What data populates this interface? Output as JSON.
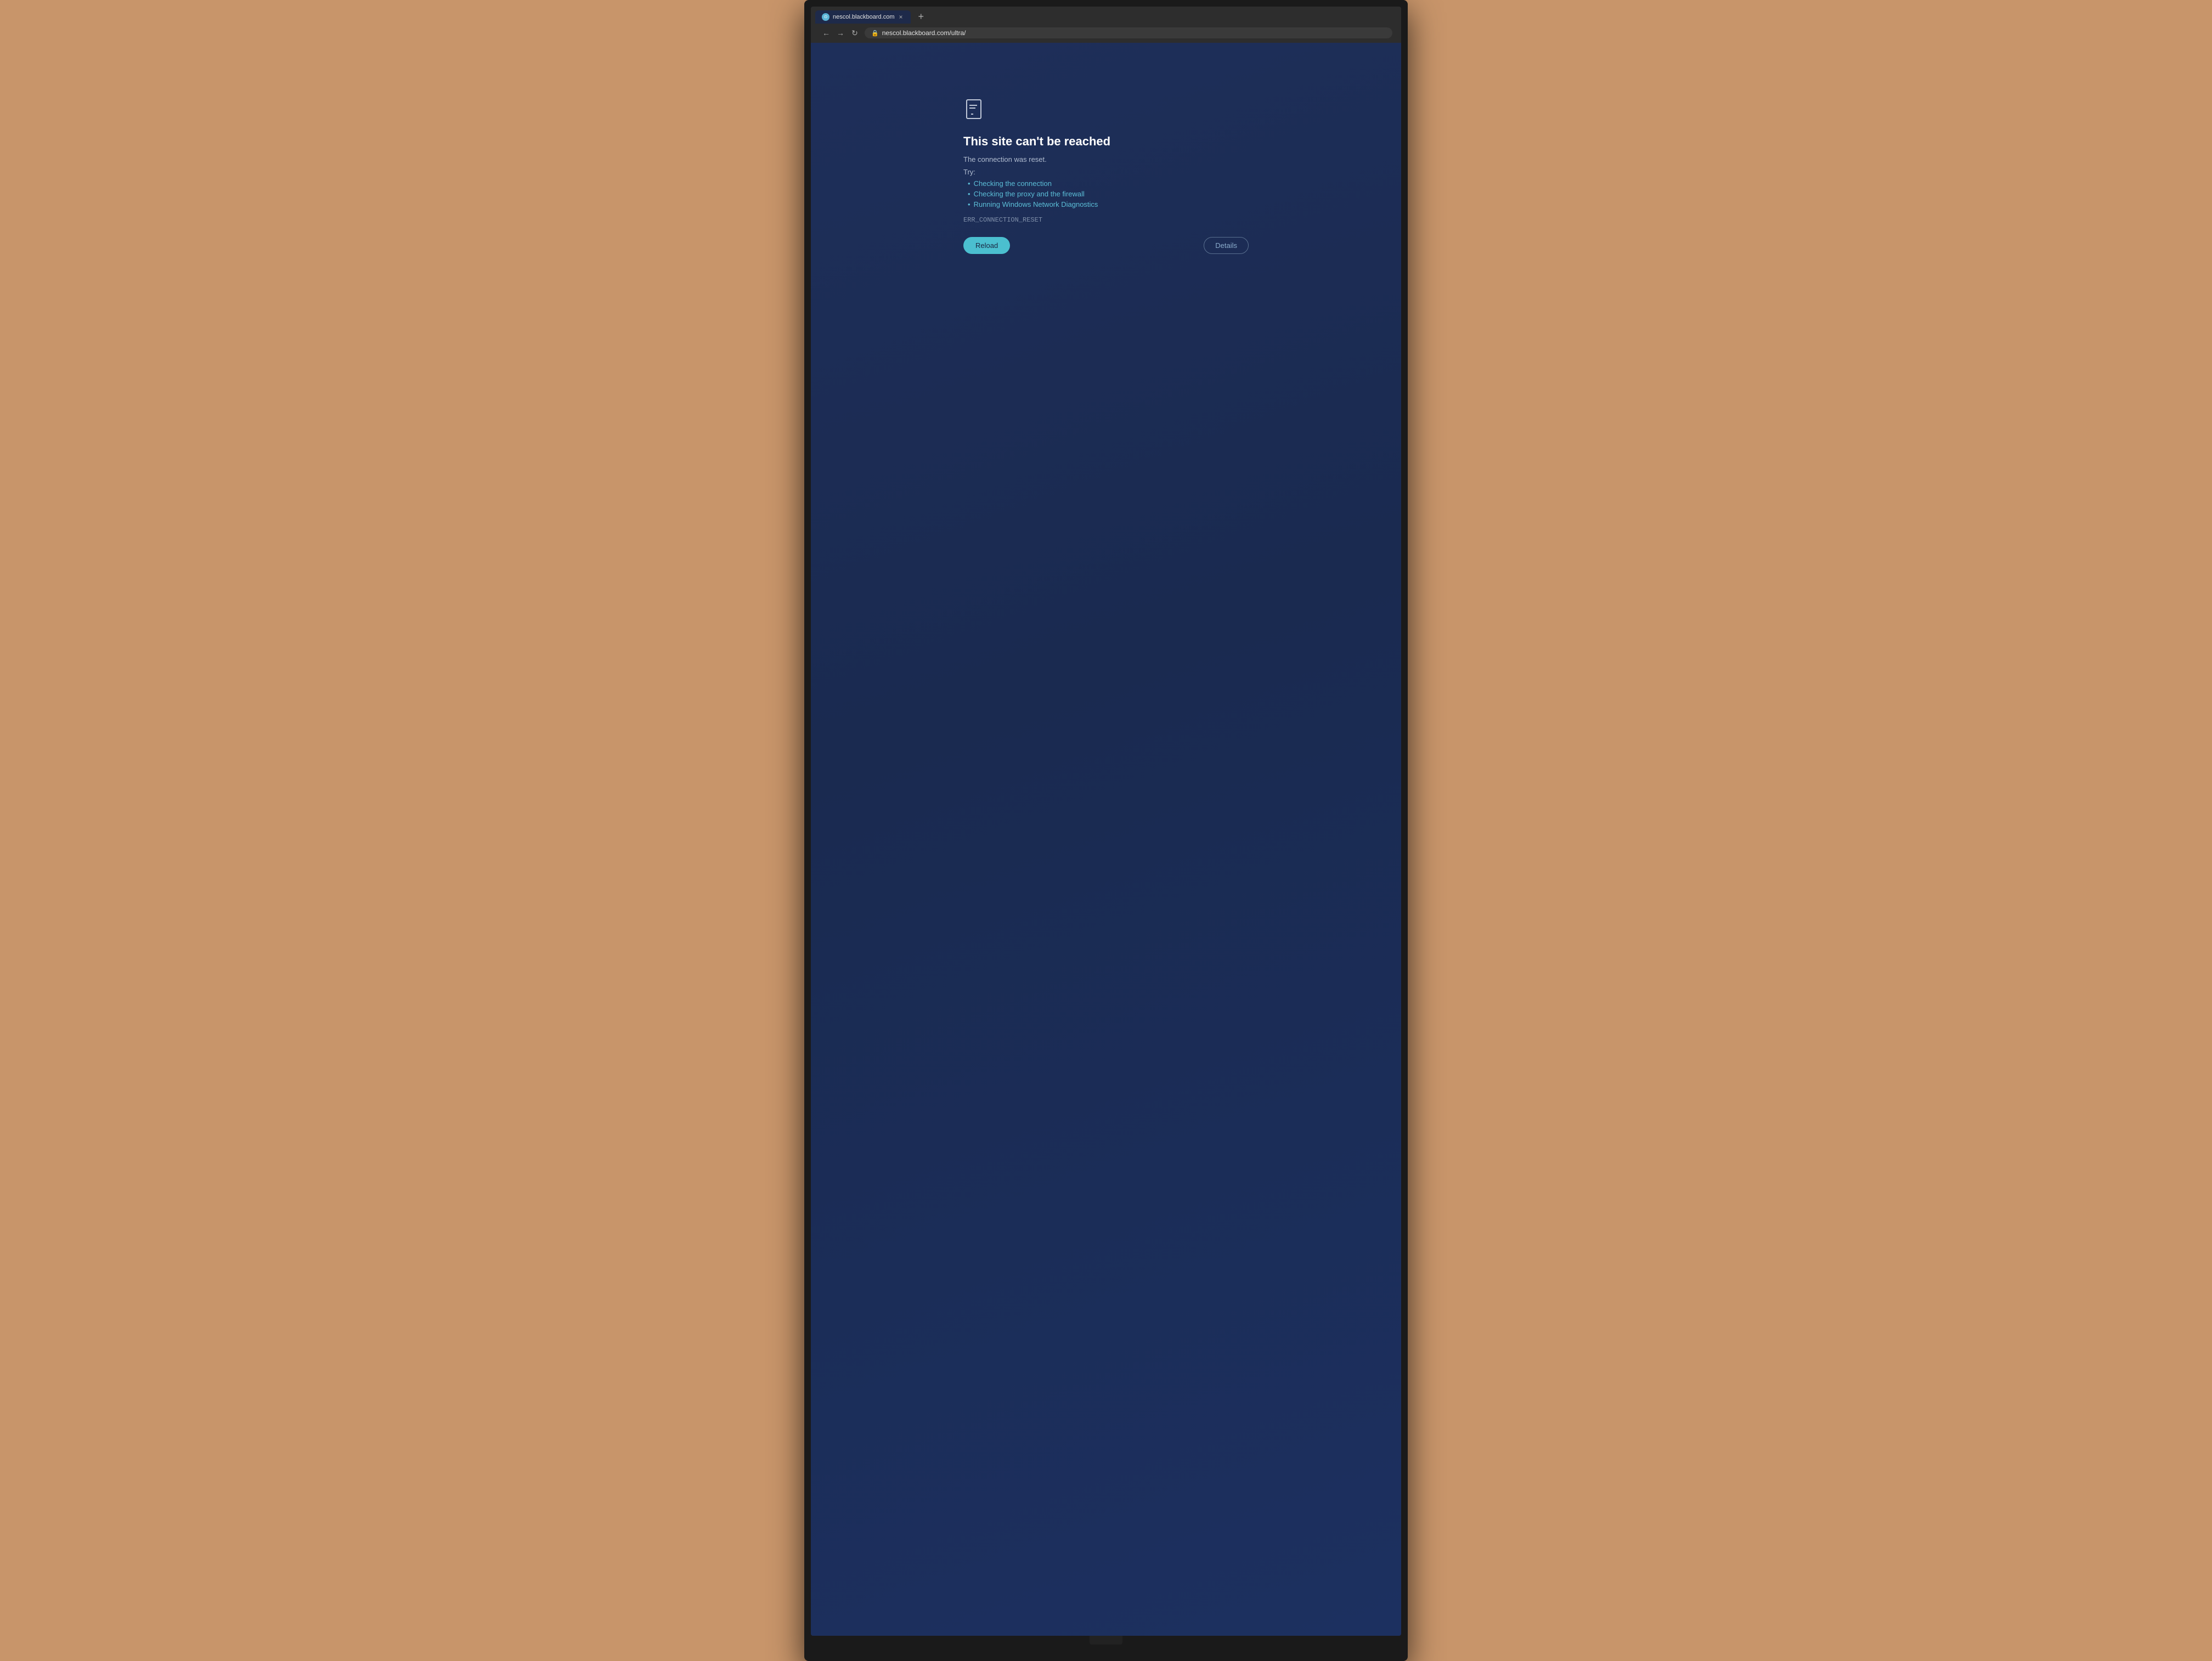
{
  "browser": {
    "tab": {
      "favicon_label": "●",
      "title": "nescol.blackboard.com",
      "close_label": "×",
      "new_tab_label": "+"
    },
    "address_bar": {
      "url": "nescol.blackboard.com/ultra/",
      "lock_icon": "🔒"
    },
    "nav": {
      "back_label": "←",
      "forward_label": "→",
      "reload_label": "↻"
    }
  },
  "error_page": {
    "title": "This site can't be reached",
    "subtitle": "The connection was reset.",
    "try_label": "Try:",
    "suggestions": [
      "Checking the connection",
      "Checking the proxy and the firewall",
      "Running Windows Network Diagnostics"
    ],
    "error_code": "ERR_CONNECTION_RESET",
    "reload_button": "Reload",
    "details_button": "Details"
  }
}
